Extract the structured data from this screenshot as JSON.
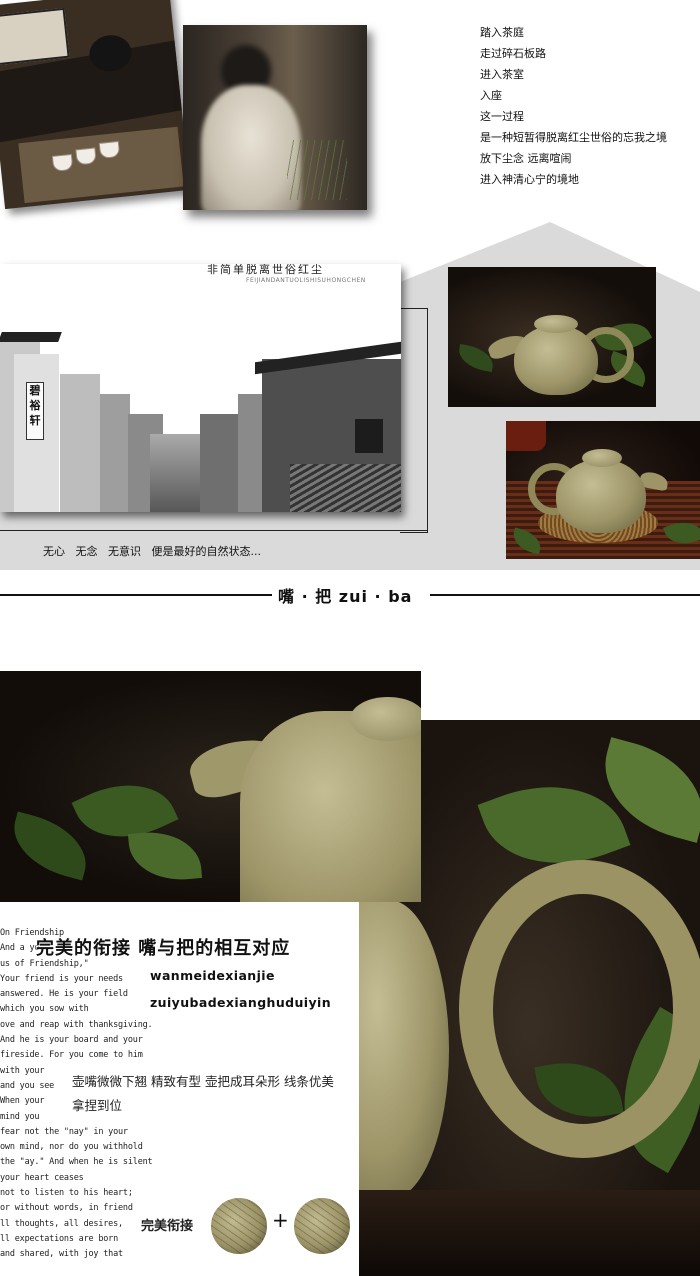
{
  "intro": {
    "poem_lines": [
      "踏入茶庭",
      "走过碎石板路",
      "进入茶室",
      "入座",
      "这一过程",
      "是一种短暂得脱离红尘世俗的忘我之境",
      "放下尘念 远离喧闹",
      "进入神清心宁的境地"
    ]
  },
  "town_photo": {
    "caption_cn": "非简单脱离世俗红尘",
    "caption_en": "FEIJIANDANTUOLISHISUHONGCHEN",
    "sign_text": "碧裕轩"
  },
  "tagline": "无心   无念   无意识   便是最好的自然状态...",
  "divider": {
    "title": "嘴 · 把  zui · ba"
  },
  "detail": {
    "heading": "完美的衔接  嘴与把的相互对应",
    "pinyin_1": "wanmeidexianjie",
    "pinyin_2": "zuiyubadexianghuduiyin",
    "description": "壶嘴微微下翘 精致有型 壶把成耳朵形 线条优美 拿捏到位",
    "bottom_label": "完美衔接",
    "plus": "+",
    "poem_en_lines": [
      "On Friendship",
      "And a yo",
      "us of Friendship,\"",
      "Your friend is your needs",
      "answered. He is your field",
      "which you sow with",
      "ove and reap with thanksgiving.",
      "And he is your board and your",
      "fireside. For you come to him",
      "with your",
      "and you see",
      "When your",
      "mind you",
      "fear not the \"nay\" in your",
      "own mind, nor do you withhold",
      "the \"ay.\" And when he is silent",
      "your heart ceases",
      "not to listen to his heart;",
      "or without words, in friend",
      "ll thoughts, all desires,",
      "ll expectations are born",
      "and shared, with joy that"
    ]
  }
}
